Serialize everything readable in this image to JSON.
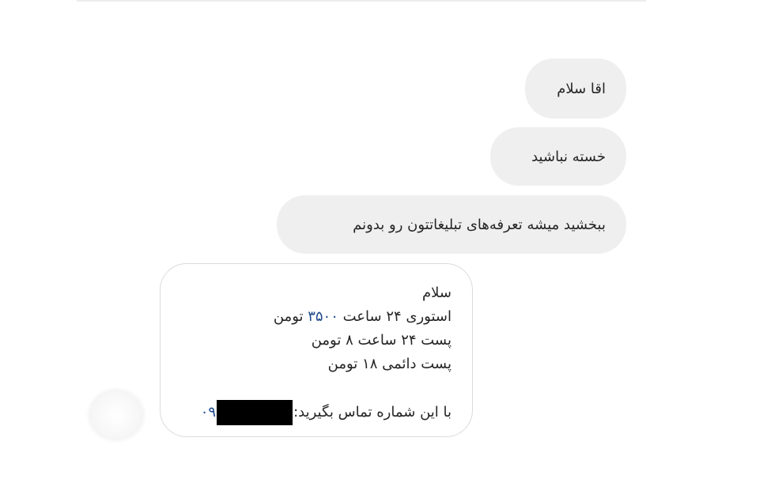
{
  "conversation": {
    "outgoing": [
      {
        "text": "اقا سلام"
      },
      {
        "text": "خسته نباشید"
      },
      {
        "text": "ببخشید میشه تعرفه‌های تبلیغاتتون رو بدونم"
      }
    ],
    "reply": {
      "greeting": "سلام",
      "story_prefix": "استوری ۲۴ ساعت ",
      "story_price": "۳۵۰۰",
      "story_suffix": " تومن",
      "post24": "پست ۲۴ ساعت ۸ تومن",
      "post_permanent": "پست دائمی ۱۸ تومن",
      "contact_label": "با این شماره تماس بگیرید:",
      "phone_prefix": "۰۹"
    }
  },
  "colors": {
    "outgoing_bubble": "#efefef",
    "reply_border": "#dbdbdb",
    "link_blue": "#1f4a8c"
  },
  "icons": {
    "avatar": "user-avatar"
  }
}
